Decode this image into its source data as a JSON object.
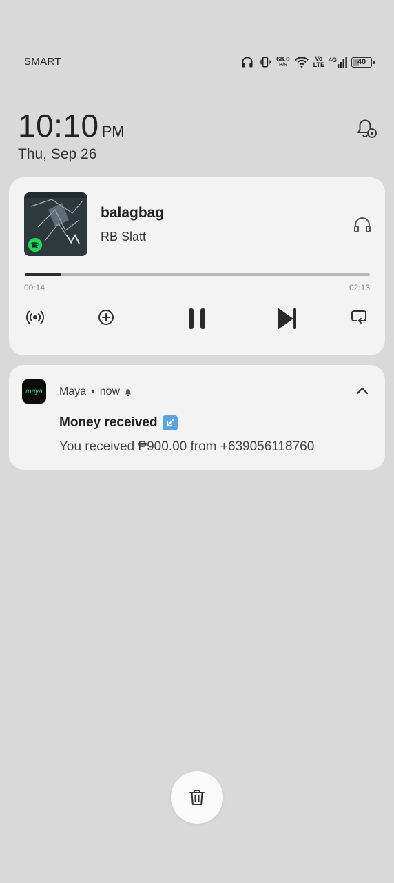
{
  "status_bar": {
    "carrier": "SMART",
    "net_speed_value": "68.0",
    "net_speed_unit": "B/S",
    "volte_top": "Vo",
    "volte_bottom": "LTE",
    "network_type": "4G",
    "battery_level": "40",
    "battery_fraction": 0.4,
    "icons": [
      "headphones-icon",
      "vibrate-icon",
      "wifi-icon",
      "signal-icon",
      "battery-icon"
    ]
  },
  "lockscreen": {
    "time": "10:10",
    "ampm": "PM",
    "date": "Thu, Sep 26",
    "notification_settings_icon": "bell-settings-icon"
  },
  "media": {
    "title": "balagbag",
    "artist": "RB Slatt",
    "elapsed": "00:14",
    "duration": "02:13",
    "progress_fraction": 0.105,
    "source_app_icon": "spotify-icon",
    "output_device_icon": "headphones-icon",
    "controls": [
      "cast-icon",
      "add-icon",
      "pause-icon",
      "skip-next-icon",
      "repeat-icon"
    ]
  },
  "notification": {
    "app_name": "Maya",
    "app_icon_text": "maya",
    "separator": "•",
    "time": "now",
    "title": "Money received",
    "body": "You received ₱900.00 from +639056118760",
    "colors": {
      "app_icon_bg": "#0b0b0b",
      "app_icon_text": "#2fe08a"
    }
  },
  "actions": {
    "clear_all_icon": "trash-icon"
  }
}
